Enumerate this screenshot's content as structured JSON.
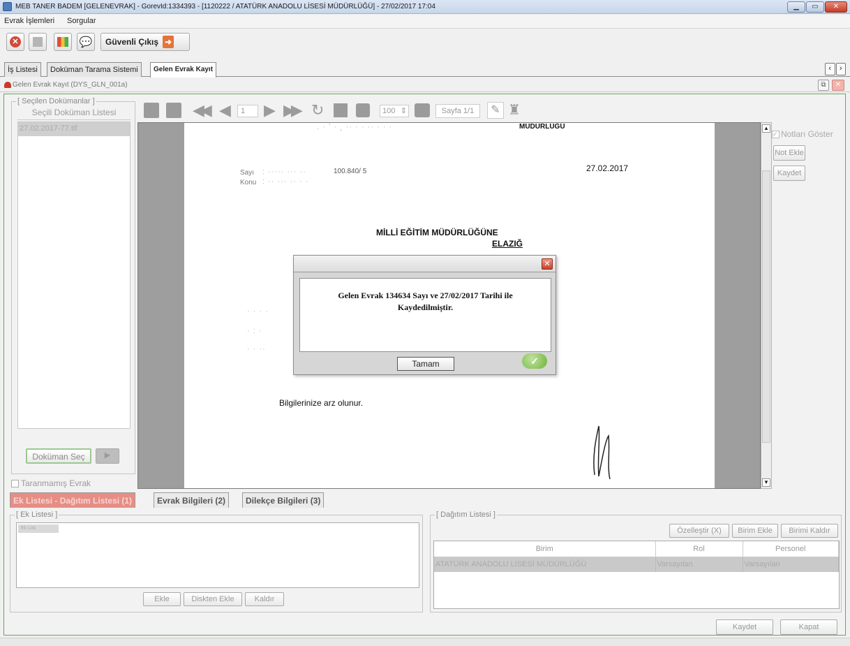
{
  "window": {
    "title": "MEB  TANER BADEM  [GELENEVRAK] - GorevId:1334393 - [1120222 / ATATÜRK ANADOLU LİSESİ MÜDÜRLÜĞÜ] - 27/02/2017 17:04",
    "min": "▁",
    "max": "▭",
    "close": "✕"
  },
  "menu": [
    "Evrak İşlemleri",
    "Sorgular"
  ],
  "toolbar": {
    "exit_label": "Güvenli Çıkış"
  },
  "tabs": [
    "İş Listesi",
    "Doküman Tarama Sistemi",
    "Gelen Evrak Kayıt"
  ],
  "frame": {
    "title": "Gelen Evrak Kayıt (DYS_GLN_001a)"
  },
  "left_panel": {
    "legend": "Seçilen Dokümanlar",
    "list_header": "Seçili Doküman Listesi",
    "selected_item": "27.02.2017-77.tif",
    "select_button": "Doküman Seç",
    "unscanned_label": "Taranmamış Evrak"
  },
  "viewer": {
    "page_number": "1",
    "zoom": "100",
    "page_label": "Sayfa 1/1"
  },
  "document": {
    "header": "MÜDÜRLÜĞÜ",
    "date": "27.02.2017",
    "sayi_label": "Sayı",
    "konu_label": "Konu",
    "sayi_value": "100.840/ 5",
    "addressee": "MİLLİ EĞİTİM MÜDÜRLÜĞÜNE",
    "city": "ELAZIĞ",
    "closing": "Bilgilerinize arz olunur."
  },
  "notes": {
    "show_label": "Notları Göster",
    "add_label": "Not Ekle",
    "save_label": "Kaydet"
  },
  "dialog": {
    "message_line1": "Gelen Evrak 134634 Sayı ve 27/02/2017 Tarihi ile",
    "message_line2": "Kaydedilmiştir.",
    "ok_label": "Tamam"
  },
  "bottom_tabs": [
    "Ek Listesi - Dağıtım Listesi (1)",
    "Evrak Bilgileri (2)",
    "Dilekçe Bilgileri (3)"
  ],
  "ek_listesi": {
    "legend": "Ek Listesi",
    "item": "Ek List",
    "buttons": [
      "Ekle",
      "Diskten Ekle",
      "Kaldır"
    ]
  },
  "dagitim": {
    "legend": "Dağıtım Listesi",
    "buttons": [
      "Özelleştir (X)",
      "Birim Ekle",
      "Birimi Kaldır"
    ],
    "columns": [
      "Birim",
      "Rol",
      "Personel"
    ],
    "rows": [
      [
        "ATATÜRK ANADOLU LİSESİ MÜDÜRLÜĞÜ",
        "Varsayılan",
        "Varsayılan"
      ]
    ]
  },
  "footer": {
    "save": "Kaydet",
    "close": "Kapat"
  }
}
